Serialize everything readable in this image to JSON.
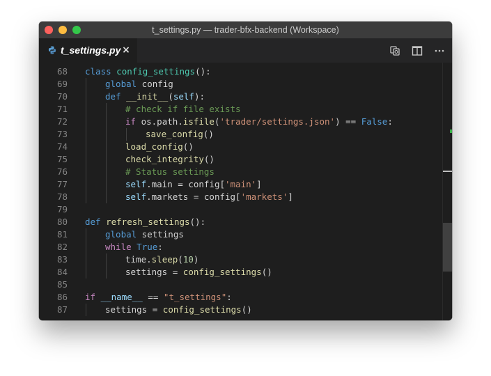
{
  "window": {
    "title": "t_settings.py — trader-bfx-backend (Workspace)"
  },
  "tab": {
    "label": "t_settings.py",
    "close": "×",
    "icon": "python-icon"
  },
  "actions": [
    {
      "name": "open-changes-icon"
    },
    {
      "name": "split-editor-icon"
    },
    {
      "name": "more-actions-icon"
    }
  ],
  "colors": {
    "keyword": "#569cd6",
    "control": "#c586c0",
    "class_name": "#4ec9b0",
    "function": "#dcdcaa",
    "string": "#ce9178",
    "number": "#b5cea8",
    "comment": "#6a9955",
    "variable": "#9cdcfe"
  },
  "lines": [
    {
      "n": "68",
      "indent": 0,
      "tokens": [
        [
          "kw",
          "class"
        ],
        [
          "op",
          " "
        ],
        [
          "cls",
          "config_settings"
        ],
        [
          "op",
          "():"
        ]
      ]
    },
    {
      "n": "69",
      "indent": 1,
      "tokens": [
        [
          "kw",
          "global"
        ],
        [
          "op",
          " config"
        ]
      ]
    },
    {
      "n": "70",
      "indent": 1,
      "tokens": [
        [
          "kw",
          "def"
        ],
        [
          "op",
          " "
        ],
        [
          "fn",
          "__init__"
        ],
        [
          "op",
          "("
        ],
        [
          "var",
          "self"
        ],
        [
          "op",
          "):"
        ]
      ]
    },
    {
      "n": "71",
      "indent": 2,
      "tokens": [
        [
          "cmt",
          "# check if file exists"
        ]
      ]
    },
    {
      "n": "72",
      "indent": 2,
      "tokens": [
        [
          "ctl",
          "if"
        ],
        [
          "op",
          " os.path."
        ],
        [
          "fn",
          "isfile"
        ],
        [
          "op",
          "("
        ],
        [
          "str",
          "'trader/settings.json'"
        ],
        [
          "op",
          ") == "
        ],
        [
          "kw",
          "False"
        ],
        [
          "op",
          ":"
        ]
      ]
    },
    {
      "n": "73",
      "indent": 3,
      "tokens": [
        [
          "fn",
          "save_config"
        ],
        [
          "op",
          "()"
        ]
      ]
    },
    {
      "n": "74",
      "indent": 2,
      "tokens": [
        [
          "fn",
          "load_config"
        ],
        [
          "op",
          "()"
        ]
      ]
    },
    {
      "n": "75",
      "indent": 2,
      "tokens": [
        [
          "fn",
          "check_integrity"
        ],
        [
          "op",
          "()"
        ]
      ]
    },
    {
      "n": "76",
      "indent": 2,
      "tokens": [
        [
          "cmt",
          "# Status settings"
        ]
      ]
    },
    {
      "n": "77",
      "indent": 2,
      "tokens": [
        [
          "var",
          "self"
        ],
        [
          "op",
          ".main = config["
        ],
        [
          "str",
          "'main'"
        ],
        [
          "op",
          "]"
        ]
      ]
    },
    {
      "n": "78",
      "indent": 2,
      "tokens": [
        [
          "var",
          "self"
        ],
        [
          "op",
          ".markets = config["
        ],
        [
          "str",
          "'markets'"
        ],
        [
          "op",
          "]"
        ]
      ]
    },
    {
      "n": "79",
      "indent": 0,
      "tokens": []
    },
    {
      "n": "80",
      "indent": 0,
      "tokens": [
        [
          "kw",
          "def"
        ],
        [
          "op",
          " "
        ],
        [
          "fn",
          "refresh_settings"
        ],
        [
          "op",
          "():"
        ]
      ]
    },
    {
      "n": "81",
      "indent": 1,
      "tokens": [
        [
          "kw",
          "global"
        ],
        [
          "op",
          " settings"
        ]
      ]
    },
    {
      "n": "82",
      "indent": 1,
      "tokens": [
        [
          "ctl",
          "while"
        ],
        [
          "op",
          " "
        ],
        [
          "kw",
          "True"
        ],
        [
          "op",
          ":"
        ]
      ]
    },
    {
      "n": "83",
      "indent": 2,
      "tokens": [
        [
          "op",
          "time."
        ],
        [
          "fn",
          "sleep"
        ],
        [
          "op",
          "("
        ],
        [
          "num",
          "10"
        ],
        [
          "op",
          ")"
        ]
      ]
    },
    {
      "n": "84",
      "indent": 2,
      "tokens": [
        [
          "op",
          "settings = "
        ],
        [
          "fn",
          "config_settings"
        ],
        [
          "op",
          "()"
        ]
      ]
    },
    {
      "n": "85",
      "indent": 0,
      "tokens": []
    },
    {
      "n": "86",
      "indent": 0,
      "tokens": [
        [
          "ctl",
          "if"
        ],
        [
          "op",
          " "
        ],
        [
          "var",
          "__name__"
        ],
        [
          "op",
          " == "
        ],
        [
          "str",
          "\"t_settings\""
        ],
        [
          "op",
          ":"
        ]
      ]
    },
    {
      "n": "87",
      "indent": 1,
      "tokens": [
        [
          "op",
          "settings = "
        ],
        [
          "fn",
          "config_settings"
        ],
        [
          "op",
          "()"
        ]
      ]
    }
  ]
}
